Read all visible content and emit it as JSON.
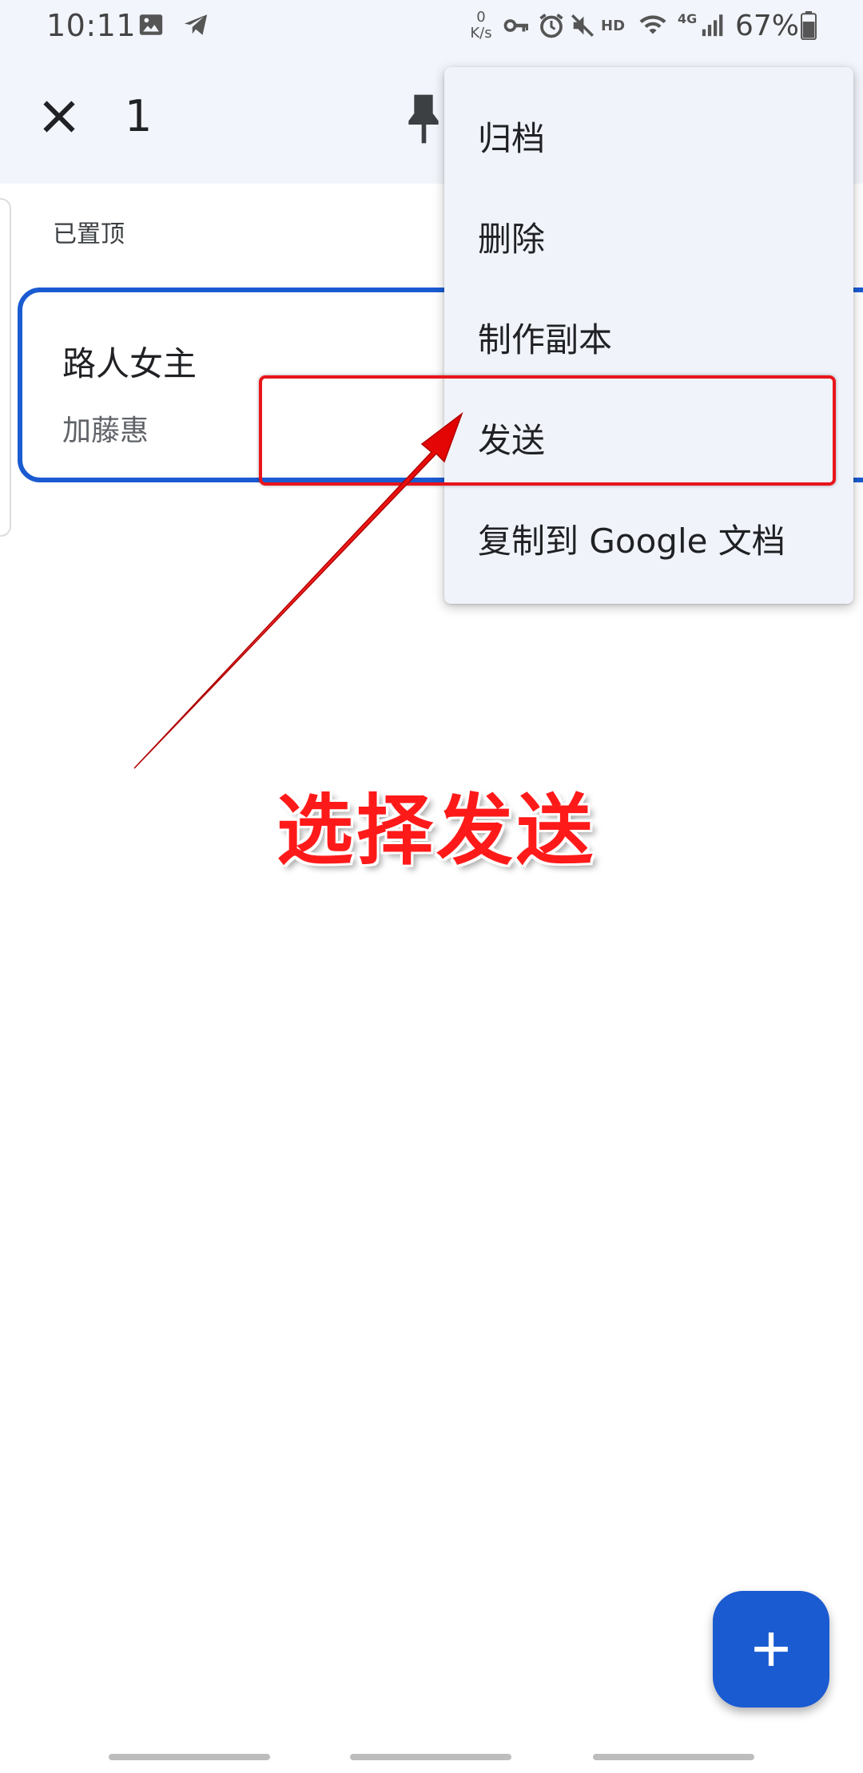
{
  "status_bar": {
    "time": "10:11",
    "net_speed_value": "0",
    "net_speed_unit": "K/s",
    "hd_label": "HD",
    "network_label": "4G",
    "battery_percent": "67%"
  },
  "app_bar": {
    "selected_count": "1"
  },
  "section": {
    "pinned_label": "已置顶"
  },
  "note": {
    "title": "路人女主",
    "body": "加藤惠"
  },
  "menu": {
    "items": [
      {
        "label": "归档"
      },
      {
        "label": "删除"
      },
      {
        "label": "制作副本"
      },
      {
        "label": "发送"
      },
      {
        "label": "复制到 Google 文档"
      }
    ]
  },
  "annotation": {
    "caption": "选择发送"
  },
  "colors": {
    "accent": "#1a5bd1",
    "annotation_red": "#e8151b",
    "bar_background": "#f2f5fb"
  }
}
